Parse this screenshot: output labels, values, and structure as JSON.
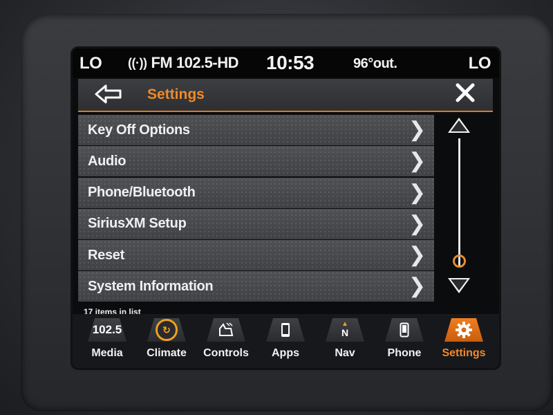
{
  "status": {
    "left_temp": "LO",
    "radio": "FM 102.5-HD",
    "time": "10:53",
    "outside_temp": "96°out.",
    "right_temp": "LO"
  },
  "header": {
    "title": "Settings",
    "back_icon": "back-arrow-icon",
    "close_icon": "close-icon"
  },
  "list": {
    "items": [
      {
        "label": "Key Off Options"
      },
      {
        "label": "Audio"
      },
      {
        "label": "Phone/Bluetooth"
      },
      {
        "label": "SiriusXM Setup"
      },
      {
        "label": "Reset"
      },
      {
        "label": "System Information"
      }
    ],
    "count_text": "17 items in list",
    "scroll_fraction": 0.95
  },
  "nav": {
    "items": [
      {
        "label": "Media",
        "icon_text": "102.5",
        "icon": "media-icon"
      },
      {
        "label": "Climate",
        "icon": "climate-icon"
      },
      {
        "label": "Controls",
        "icon": "controls-icon"
      },
      {
        "label": "Apps",
        "icon": "apps-icon"
      },
      {
        "label": "Nav",
        "icon_text": "N",
        "icon": "compass-icon"
      },
      {
        "label": "Phone",
        "icon": "phone-icon"
      },
      {
        "label": "Settings",
        "icon": "gear-icon",
        "active": true
      }
    ]
  },
  "colors": {
    "accent": "#ee8a2a",
    "text": "#f0f0f0",
    "background": "#0b0c0e"
  }
}
